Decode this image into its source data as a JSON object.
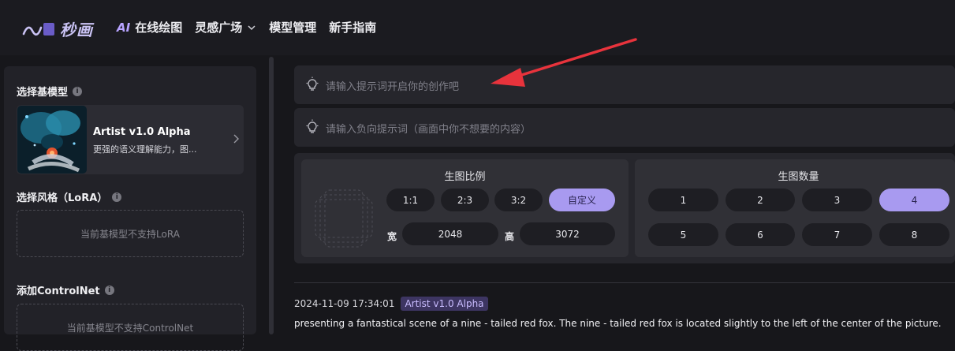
{
  "brand": {
    "name": "秒画"
  },
  "nav": {
    "ai_prefix": "AI",
    "items": [
      {
        "label": "在线绘图"
      },
      {
        "label": "灵感广场"
      },
      {
        "label": "模型管理"
      },
      {
        "label": "新手指南"
      }
    ]
  },
  "left": {
    "base_model_title": "选择基模型",
    "model": {
      "name": "Artist v1.0 Alpha",
      "desc": "更强的语义理解能力，图..."
    },
    "lora_title": "选择风格（LoRA）",
    "lora_empty": "当前基模型不支持LoRA",
    "controlnet_title": "添加ControlNet",
    "controlnet_empty": "当前基模型不支持ControlNet"
  },
  "prompt": {
    "positive_placeholder": "请输入提示词开启你的创作吧",
    "negative_placeholder": "请输入负向提示词（画面中你不想要的内容）"
  },
  "ratio": {
    "title": "生图比例",
    "options": [
      "1:1",
      "2:3",
      "3:2",
      "自定义"
    ],
    "selected": "自定义",
    "width_label": "宽",
    "width_value": "2048",
    "height_label": "高",
    "height_value": "3072"
  },
  "count": {
    "title": "生图数量",
    "options": [
      "1",
      "2",
      "3",
      "4",
      "5",
      "6",
      "7",
      "8"
    ],
    "selected": "4"
  },
  "history": {
    "time": "2024-11-09 17:34:01",
    "model_tag": "Artist v1.0 Alpha",
    "text": "presenting a fantastical scene of a nine - tailed red fox. The nine - tailed red fox is located slightly to the left of the center of the picture."
  },
  "colors": {
    "accent": "#a89af0",
    "annotation_arrow": "#e8333c"
  },
  "icons": {
    "info": "info-icon",
    "bulb": "lightbulb-icon",
    "chevron": "chevron-down-icon",
    "arrow": "chevron-right-icon"
  }
}
